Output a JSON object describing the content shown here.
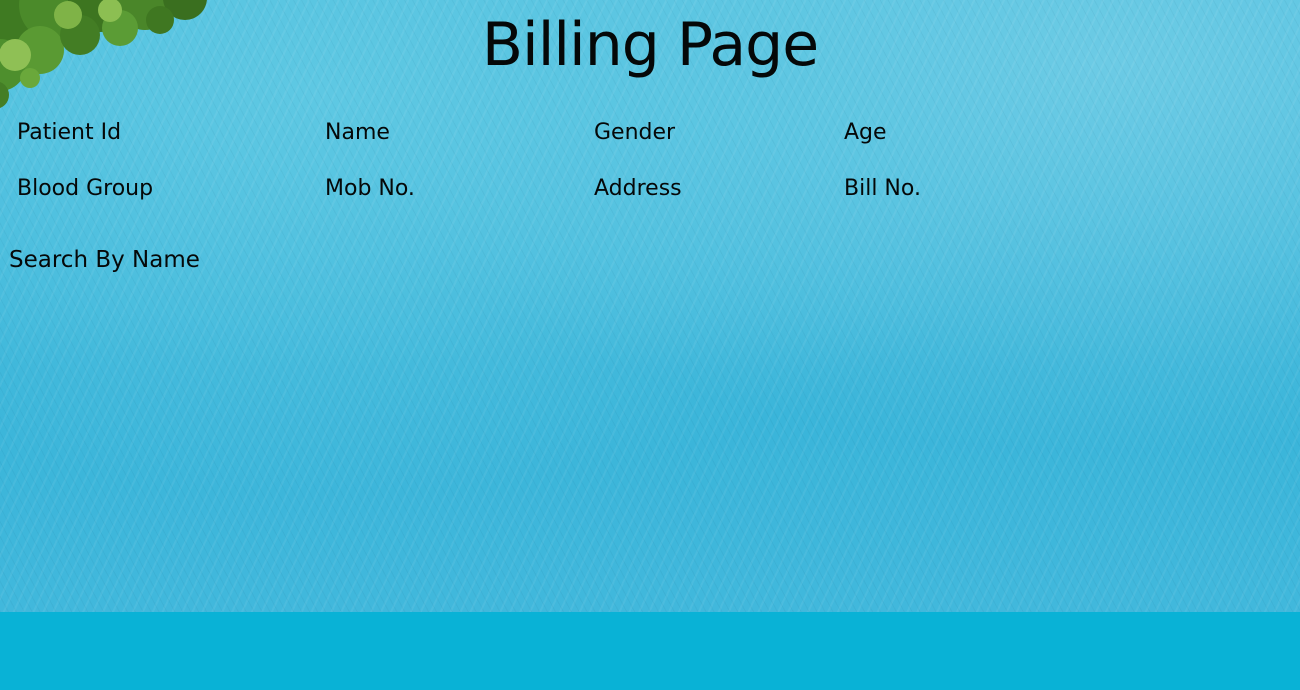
{
  "page": {
    "title": "Billing Page"
  },
  "patient_fields": {
    "row1": [
      "Patient Id",
      "Name",
      "Gender",
      "Age"
    ],
    "row2": [
      "Blood Group",
      "Mob No.",
      "Address",
      "Bill No."
    ]
  },
  "search": {
    "label": "Search By Name"
  },
  "colors": {
    "water": "#41b8dc",
    "footer": "#09b2d6",
    "text": "#050808",
    "foliage": "#4f8a2c"
  }
}
